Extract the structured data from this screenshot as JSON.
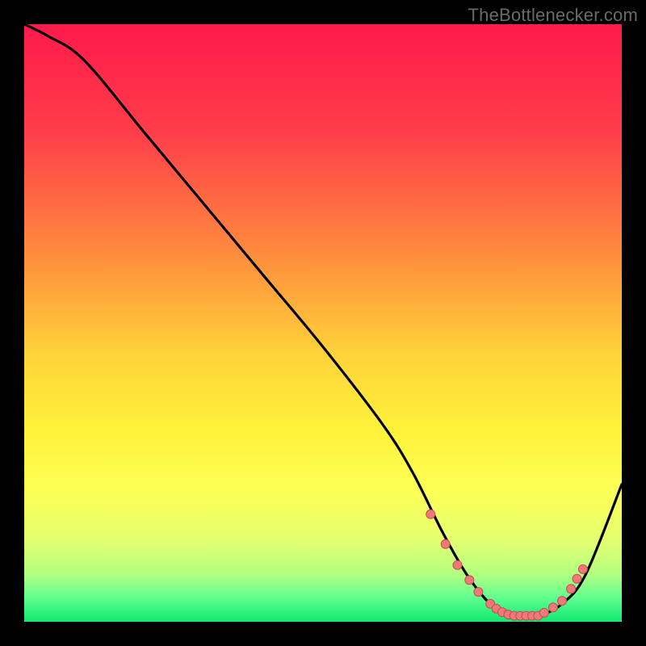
{
  "watermark": "TheBottlenecker.com",
  "chart_data": {
    "type": "line",
    "title": "",
    "xlabel": "",
    "ylabel": "",
    "xlim": [
      0,
      100
    ],
    "ylim": [
      0,
      100
    ],
    "series": [
      {
        "name": "bottleneck-curve",
        "x": [
          0,
          4,
          10,
          20,
          30,
          40,
          50,
          60,
          65,
          70,
          74,
          78,
          82,
          86,
          90,
          94,
          100
        ],
        "y": [
          100,
          98,
          94,
          82,
          70,
          58,
          46,
          33,
          25,
          15,
          8,
          3,
          1,
          1,
          3,
          8,
          23
        ]
      }
    ],
    "markers": {
      "name": "highlighted-points",
      "x": [
        68,
        70.5,
        72.5,
        74.5,
        76,
        78,
        79,
        80,
        81,
        82,
        83,
        84,
        85,
        86,
        87,
        88.5,
        90,
        91.5,
        92.5,
        93.5
      ],
      "y": [
        18,
        13,
        9.5,
        7,
        5,
        3,
        2.2,
        1.6,
        1.2,
        1,
        1,
        1,
        1,
        1,
        1.5,
        2.4,
        3.5,
        5.5,
        7.2,
        8.8
      ]
    },
    "gradient_stops": [
      {
        "pct": 0,
        "color": "#ff1a4b"
      },
      {
        "pct": 18,
        "color": "#ff3d4a"
      },
      {
        "pct": 38,
        "color": "#ff8a3e"
      },
      {
        "pct": 55,
        "color": "#ffd23a"
      },
      {
        "pct": 68,
        "color": "#fff23a"
      },
      {
        "pct": 78,
        "color": "#fdff55"
      },
      {
        "pct": 86,
        "color": "#e6ff70"
      },
      {
        "pct": 92,
        "color": "#b3ff80"
      },
      {
        "pct": 96,
        "color": "#60ff90"
      },
      {
        "pct": 100,
        "color": "#10e870"
      }
    ]
  }
}
